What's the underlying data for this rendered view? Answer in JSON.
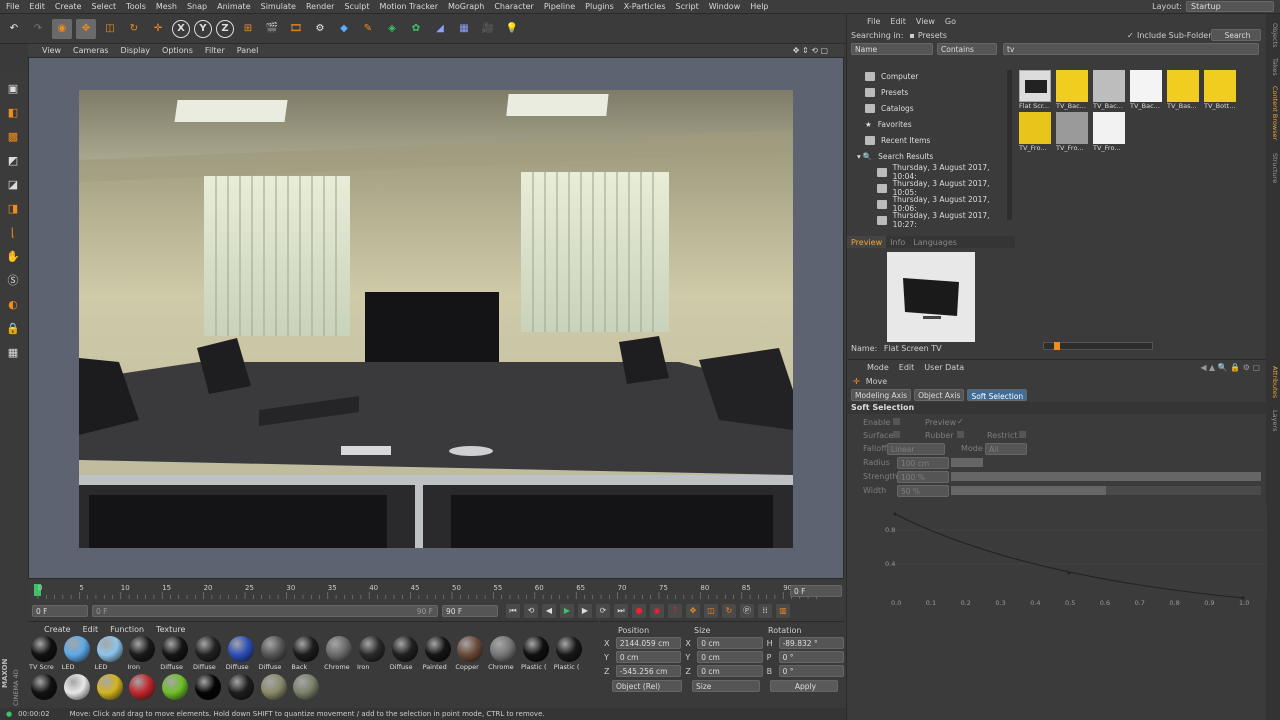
{
  "menubar": {
    "items": [
      "File",
      "Edit",
      "Create",
      "Select",
      "Tools",
      "Mesh",
      "Snap",
      "Animate",
      "Simulate",
      "Render",
      "Sculpt",
      "Motion Tracker",
      "MoGraph",
      "Character",
      "Pipeline",
      "Plugins",
      "X-Particles",
      "Script",
      "Window",
      "Help"
    ],
    "layout_label": "Layout:",
    "layout_value": "Startup"
  },
  "viewport_menu": [
    "View",
    "Cameras",
    "Display",
    "Options",
    "Filter",
    "Panel"
  ],
  "timeline": {
    "ticks": [
      "0",
      "5",
      "10",
      "15",
      "20",
      "25",
      "30",
      "35",
      "40",
      "45",
      "50",
      "55",
      "60",
      "65",
      "70",
      "75",
      "80",
      "85",
      "90"
    ],
    "current_frame": "0 F",
    "start_frame": "0 F",
    "range_start": "0 F",
    "range_end": "90 F",
    "end_frame": "90 F"
  },
  "material_menu": [
    "Create",
    "Edit",
    "Function",
    "Texture"
  ],
  "materials": [
    {
      "label": "TV Scre",
      "color": "#111111"
    },
    {
      "label": "LED",
      "color": "#5fa8e8"
    },
    {
      "label": "LED",
      "color": "#8ec4ea"
    },
    {
      "label": "Iron",
      "color": "#1a1a1a"
    },
    {
      "label": "Diffuse",
      "color": "#151515"
    },
    {
      "label": "Diffuse",
      "color": "#222222"
    },
    {
      "label": "Diffuse",
      "color": "#2d4fb8"
    },
    {
      "label": "Diffuse",
      "color": "#555555"
    },
    {
      "label": "Back",
      "color": "#1c1c1c"
    },
    {
      "label": "Chrome",
      "color": "#6a6a6a"
    },
    {
      "label": "Iron",
      "color": "#2a2a2a"
    },
    {
      "label": "Diffuse",
      "color": "#202020"
    },
    {
      "label": "Painted",
      "color": "#151515"
    },
    {
      "label": "Copper",
      "color": "#6b4a3a"
    },
    {
      "label": "Chrome",
      "color": "#777777"
    },
    {
      "label": "Plastic (",
      "color": "#101010"
    },
    {
      "label": "Plastic (",
      "color": "#181818"
    },
    {
      "label": "",
      "color": "#121212"
    },
    {
      "label": "",
      "color": "#e8e8e8"
    },
    {
      "label": "",
      "color": "#d4b421"
    },
    {
      "label": "",
      "color": "#c0272d"
    },
    {
      "label": "",
      "color": "#6fbf28"
    },
    {
      "label": "",
      "color": "#050505"
    },
    {
      "label": "",
      "color": "#1e1e1e"
    },
    {
      "label": "",
      "color": "#8a8a6a"
    },
    {
      "label": "",
      "color": "#7a806a"
    }
  ],
  "coords": {
    "headers": [
      "Position",
      "Size",
      "Rotation"
    ],
    "rows": [
      {
        "axis": "X",
        "pos": "2144.059 cm",
        "saxis": "X",
        "size": "0 cm",
        "raxis": "H",
        "rot": "-89.832 °"
      },
      {
        "axis": "Y",
        "pos": "0 cm",
        "saxis": "Y",
        "size": "0 cm",
        "raxis": "P",
        "rot": "0 °"
      },
      {
        "axis": "Z",
        "pos": "-545.256 cm",
        "saxis": "Z",
        "size": "0 cm",
        "raxis": "B",
        "rot": "0 °"
      }
    ],
    "mode": "Object (Rel)",
    "size_mode": "Size",
    "apply": "Apply"
  },
  "status": {
    "time": "00:00:02",
    "message": "Move: Click and drag to move elements. Hold down SHIFT to quantize movement / add to the selection in point mode, CTRL to remove."
  },
  "brand": {
    "line1": "MAXON",
    "line2": "CINEMA 4D"
  },
  "content_browser": {
    "menu": [
      "File",
      "Edit",
      "View",
      "Go"
    ],
    "searching_in_label": "Searching in:",
    "searching_in_value": "Presets",
    "include_sub": "Include Sub-Folders",
    "search_btn": "Search",
    "filter_field": "Name",
    "filter_mode": "Contains",
    "query": "tv",
    "tree": [
      "Computer",
      "Presets",
      "Catalogs",
      "Favorites",
      "Recent Items",
      "Search Results"
    ],
    "results": [
      "Thursday, 3 August 2017, 10:04:",
      "Thursday, 3 August 2017, 10:05:",
      "Thursday, 3 August 2017, 10:06:",
      "Thursday, 3 August 2017, 10:27:"
    ],
    "tabs": [
      "Preview",
      "Info",
      "Languages"
    ],
    "name_label": "Name:",
    "name_value": "Flat Screen TV",
    "thumbs": [
      {
        "label": "Flat Scr...",
        "color": "#dcdcdc"
      },
      {
        "label": "TV_Bac...",
        "color": "#f0cd1e"
      },
      {
        "label": "TV_Bac...",
        "color": "#bdbdbd"
      },
      {
        "label": "TV_Bac...",
        "color": "#f4f4f4"
      },
      {
        "label": "TV_Bas...",
        "color": "#f0cd1e"
      },
      {
        "label": "TV_Bott...",
        "color": "#f0cd1e"
      },
      {
        "label": "TV_Fro...",
        "color": "#e8c51a"
      },
      {
        "label": "TV_Fro...",
        "color": "#9a9a9a"
      },
      {
        "label": "TV_Fro...",
        "color": "#f2f2f2"
      }
    ]
  },
  "right_tabs": [
    "Objects",
    "Takes",
    "Content Browser",
    "Structure",
    "Attributes",
    "Layers"
  ],
  "attributes": {
    "menu": [
      "Mode",
      "Edit",
      "User Data"
    ],
    "tool": "Move",
    "tabs": [
      "Modeling Axis",
      "Object Axis",
      "Soft Selection"
    ],
    "section": "Soft Selection",
    "enable": "Enable",
    "preview": "Preview",
    "surface": "Surface",
    "rubber": "Rubber",
    "restrict": "Restrict",
    "falloff_label": "Falloff",
    "falloff_value": "Linear",
    "mode_label": "Mode",
    "mode_value": "All",
    "radius_label": "Radius",
    "radius_value": "100 cm",
    "strength_label": "Strength",
    "strength_value": "100 %",
    "width_label": "Width",
    "width_value": "50 %",
    "graph_y": [
      "0.8",
      "0.4"
    ],
    "graph_x": [
      "0.0",
      "0.1",
      "0.2",
      "0.3",
      "0.4",
      "0.5",
      "0.6",
      "0.7",
      "0.8",
      "0.9",
      "1.0"
    ]
  }
}
